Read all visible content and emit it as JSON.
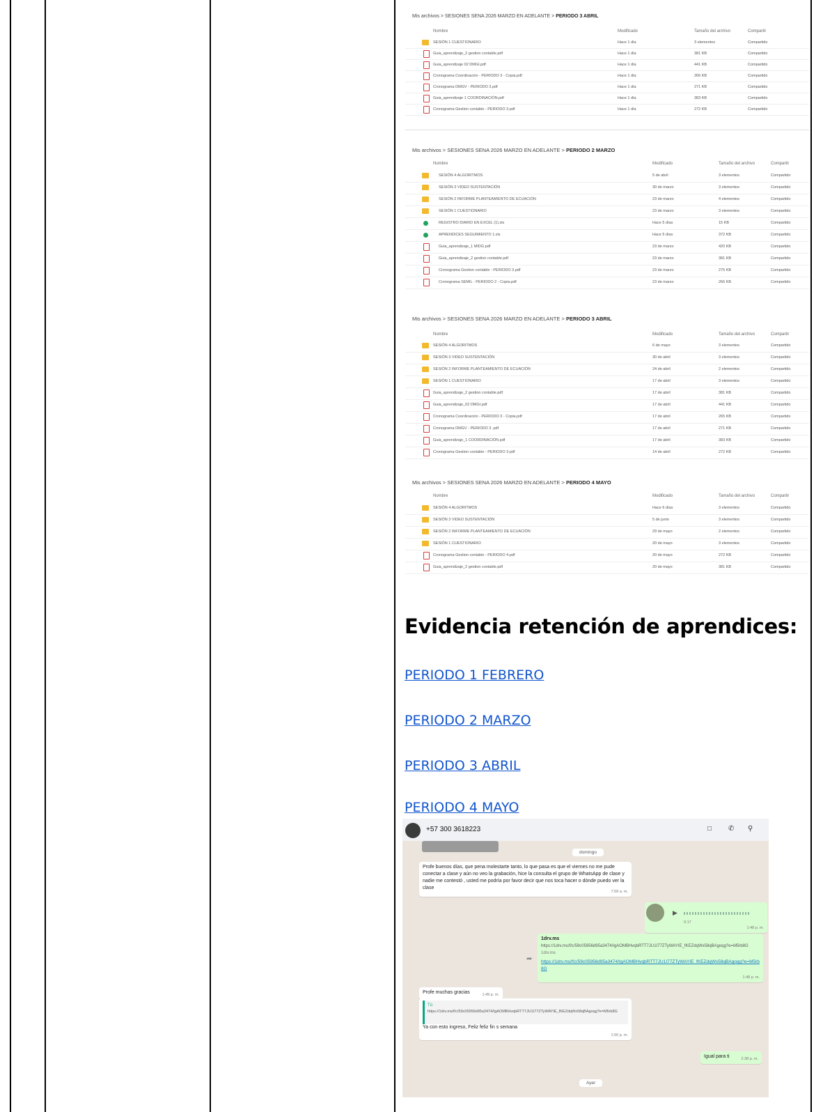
{
  "drive1": {
    "breadcrumb_root": "Mis archivos",
    "breadcrumb_mid": "SESIONES SENA 2026 MARZO EN ADELANTE",
    "breadcrumb_current": "PERIODO 3 ABRIL",
    "headers": {
      "name": "Nombre",
      "modified": "Modificado",
      "size": "Tamaño del archivo",
      "share": "Compartir"
    },
    "rows": [
      {
        "icon": "folder",
        "name": "SESIÓN 1 CUESTIONARIO",
        "modified": "Hace 1 día",
        "size": "3 elementos",
        "share": "Compartido"
      },
      {
        "icon": "pdf",
        "name": "Guia_aprendizaje_2 gestion contable.pdf",
        "modified": "Hace 1 día",
        "size": "381 KB",
        "share": "Compartido"
      },
      {
        "icon": "pdf",
        "name": "Guia_aprendizaje 02 DMGI.pdf",
        "modified": "Hace 1 día",
        "size": "441 KB",
        "share": "Compartido"
      },
      {
        "icon": "pdf",
        "name": "Cronograma Coordinación - PERIODO 3 - Copia.pdf",
        "modified": "Hace 1 día",
        "size": "266 KB",
        "share": "Compartido"
      },
      {
        "icon": "pdf",
        "name": "Cronograma DMGV - PERIODO 3.pdf",
        "modified": "Hace 1 día",
        "size": "271 KB",
        "share": "Compartido"
      },
      {
        "icon": "pdf",
        "name": "Guia_aprendizaje 1 COORDINACIÓN.pdf",
        "modified": "Hace 1 día",
        "size": "383 KB",
        "share": "Compartido"
      },
      {
        "icon": "pdf",
        "name": "Cronograma Gestion contable - PERIODO 3.pdf",
        "modified": "Hace 1 día",
        "size": "272 KB",
        "share": "Compartido"
      }
    ]
  },
  "drive2": {
    "breadcrumb_root": "Mis archivos",
    "breadcrumb_mid": "SESIONES SENA 2026 MARZO EN ADELANTE",
    "breadcrumb_current": "PERIODO 2 MARZO",
    "headers": {
      "name": "Nombre",
      "modified": "Modificado",
      "size": "Tamaño del archivo",
      "share": "Compartir"
    },
    "rows": [
      {
        "icon": "folder",
        "name": "SESIÓN 4 ALGORITMOS",
        "modified": "5 de abril",
        "size": "3 elementos",
        "share": "Compartido"
      },
      {
        "icon": "folder",
        "name": "SESIÓN 3 VIDEO SUSTENTACIÓN",
        "modified": "30 de marzo",
        "size": "3 elementos",
        "share": "Compartido"
      },
      {
        "icon": "folder",
        "name": "SESIÓN 2 INFORME PLANTEAMIENTO DE ECUACIÓN",
        "modified": "23 de marzo",
        "size": "4 elementos",
        "share": "Compartido"
      },
      {
        "icon": "folder",
        "name": "SESIÓN 1 CUESTIONARIO",
        "modified": "23 de marzo",
        "size": "3 elementos",
        "share": "Compartido"
      },
      {
        "icon": "xls",
        "name": "REGISTRO DIARIO EN EXCEL (1).xls",
        "modified": "Hace 5 días",
        "size": "15 KB",
        "share": "Compartido"
      },
      {
        "icon": "xls",
        "name": "APRENDICES SEGUIMIENTO 1.xls",
        "modified": "Hace 5 días",
        "size": "372 KB",
        "share": "Compartido"
      },
      {
        "icon": "pdf",
        "name": "Guia_aprendizaje_1 MIDG.pdf",
        "modified": "23 de marzo",
        "size": "420 KB",
        "share": "Compartido"
      },
      {
        "icon": "pdf",
        "name": "Guia_aprendizaje_2 gestion contable.pdf",
        "modified": "23 de marzo",
        "size": "381 KB",
        "share": "Compartido"
      },
      {
        "icon": "pdf",
        "name": "Cronograma Gestion contable - PERIODO 3.pdf",
        "modified": "23 de marzo",
        "size": "275 KB",
        "share": "Compartido"
      },
      {
        "icon": "pdf",
        "name": "Cronograma SEMIL - PERIODO 2 - Copia.pdf",
        "modified": "23 de marzo",
        "size": "266 KB",
        "share": "Compartido"
      }
    ]
  },
  "drive3": {
    "breadcrumb_root": "Mis archivos",
    "breadcrumb_mid": "SESIONES SENA 2026 MARZO EN ADELANTE",
    "breadcrumb_current": "PERIODO 3 ABRIL",
    "headers": {
      "name": "Nombre",
      "modified": "Modificado",
      "size": "Tamaño del archivo",
      "share": "Compartir"
    },
    "rows": [
      {
        "icon": "folder",
        "name": "SESIÓN 4 ALGORITMOS",
        "modified": "6 de mayo",
        "size": "3 elementos",
        "share": "Compartido"
      },
      {
        "icon": "folder",
        "name": "SESIÓN 3 VIDEO SUSTENTACIÓN",
        "modified": "30 de abril",
        "size": "3 elementos",
        "share": "Compartido"
      },
      {
        "icon": "folder",
        "name": "SESIÓN 2 INFORME PLANTEAMIENTO DE ECUACIÓN",
        "modified": "24 de abril",
        "size": "2 elementos",
        "share": "Compartido"
      },
      {
        "icon": "folder",
        "name": "SESIÓN 1 CUESTIONARIO",
        "modified": "17 de abril",
        "size": "3 elementos",
        "share": "Compartido"
      },
      {
        "icon": "pdf",
        "name": "Guia_aprendizaje_2 gestion contable.pdf",
        "modified": "17 de abril",
        "size": "381 KB",
        "share": "Compartido"
      },
      {
        "icon": "pdf",
        "name": "Guia_aprendizaje_02 DMGI.pdf",
        "modified": "17 de abril",
        "size": "441 KB",
        "share": "Compartido"
      },
      {
        "icon": "pdf",
        "name": "Cronograma Coordinación - PERIODO 3 - Copia.pdf",
        "modified": "17 de abril",
        "size": "265 KB",
        "share": "Compartido"
      },
      {
        "icon": "pdf",
        "name": "Cronograma DMGV - PERIODO 3 .pdf",
        "modified": "17 de abril",
        "size": "271 KB",
        "share": "Compartido"
      },
      {
        "icon": "pdf",
        "name": "Guia_aprendizaje_1 COORDINACIÓN.pdf",
        "modified": "17 de abril",
        "size": "383 KB",
        "share": "Compartido"
      },
      {
        "icon": "pdf",
        "name": "Cronograma Gestion contable - PERIODO 3.pdf",
        "modified": "14 de abril",
        "size": "272 KB",
        "share": "Compartido"
      }
    ]
  },
  "drive4": {
    "breadcrumb_root": "Mis archivos",
    "breadcrumb_mid": "SESIONES SENA 2026 MARZO EN ADELANTE",
    "breadcrumb_current": "PERIODO 4 MAYO",
    "headers": {
      "name": "Nombre",
      "modified": "Modificado",
      "size": "Tamaño del archivo",
      "share": "Compartir"
    },
    "rows": [
      {
        "icon": "folder",
        "name": "SESIÓN 4 ALGORITMOS",
        "modified": "Hace 6 días",
        "size": "3 elementos",
        "share": "Compartido"
      },
      {
        "icon": "folder",
        "name": "SESIÓN 3 VIDEO SUSTENTACIÓN",
        "modified": "5 de junio",
        "size": "3 elementos",
        "share": "Compartido"
      },
      {
        "icon": "folder",
        "name": "SESIÓN 2 INFORME PLANTEAMIENTO DE ECUACIÓN",
        "modified": "29 de mayo",
        "size": "2 elementos",
        "share": "Compartido"
      },
      {
        "icon": "folder",
        "name": "SESIÓN 1 CUESTIONARIO",
        "modified": "20 de mayo",
        "size": "3 elementos",
        "share": "Compartido"
      },
      {
        "icon": "pdf",
        "name": "Cronograma Gestion contable - PERIODO 4.pdf",
        "modified": "20 de mayo",
        "size": "272 KB",
        "share": "Compartido"
      },
      {
        "icon": "pdf",
        "name": "Guia_aprendizaje_2 gestion contable.pdf",
        "modified": "20 de mayo",
        "size": "381 KB",
        "share": "Compartido"
      }
    ]
  },
  "evidence": {
    "title": "Evidencia retención de aprendices:",
    "links": [
      "PERIODO 1 FEBRERO",
      "PERIODO 2 MARZO",
      "PERIODO 3 ABRIL",
      "PERIODO 4 MAYO"
    ]
  },
  "whatsapp": {
    "contact": "+57 300 3618223",
    "day_top": "domingo",
    "msg1": "Profe buenos días, que pena molestarte tanto, lo que pasa es que el viernes no me pude conectar a clase y aún no veo la grabación, hice la consulta el grupo de WhatsApp de clase y nadie me contestó , usted me podría por favor decir que nos toca hacer o dónde puedo ver la clase",
    "msg1_time": "7:09 a. m.",
    "audio_duration": "0:17",
    "audio_time": "1:48 p. m.",
    "link_title": "1drv.ms",
    "link_preview": "https://1drv.ms/f/c/59c05956d95a3474/IgAOMBHvqbRTT7JU1I77ZTyWAYIE_fKEZdqWx58qBAgoqg?e=M5rb8G",
    "link_domain": "1drv.ms",
    "link_url": "https://1drv.ms/f/c/59c05956d95a3474/IgAOMBHvqbRTT7JU1I77ZTyWAYIE_fKEZdqWx58qBAgoqg?e=M5rb8G",
    "link_time": "1:48 p. m.",
    "msg2": "Profe muchas gracias",
    "msg2_time": "1:49 p. m.",
    "quote_author": "Tú",
    "quote_text": "https://1drv.ms/f/c/59c05956d95a3474/IgAOMBHvqbRTT7JU1I77ZTyWAYIE_fKEZdqWx58qBAgoqg?e=M5rb8G",
    "msg3": "Ya con esto ingreso, Feliz feliz fin s semana",
    "msg3_time": "1:50 p. m.",
    "msg4": "Igual para ti",
    "msg4_time": "2:38 p. m.",
    "day_bottom": "Ayer"
  }
}
